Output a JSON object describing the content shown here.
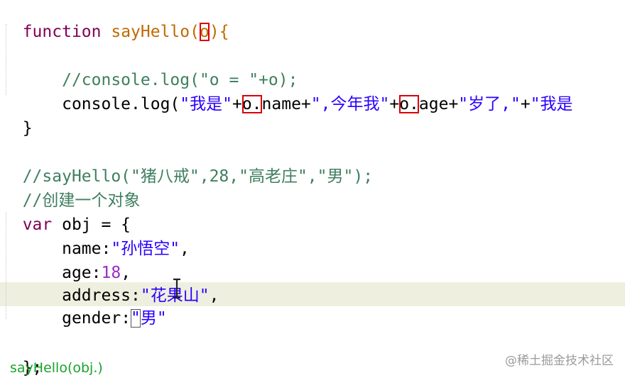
{
  "editor": {
    "lines": {
      "l1": {
        "kw": "function",
        "sp": " ",
        "fn": "sayHello",
        "open": "(",
        "param": "o",
        "close": "){"
      },
      "l3": {
        "text": "    //console.log(\"o = \"+o);"
      },
      "l4": {
        "indent": "    ",
        "call": "console.log(",
        "s1": "\"我是\"",
        "plus1": "+",
        "o1": "o.",
        "name": "name",
        "plus2": "+",
        "s2": "\",今年我\"",
        "plus3": "+",
        "o2": "o.",
        "age": "age",
        "plus4": "+",
        "s3": "\"岁了,\"",
        "plus5": "+",
        "s4": "\"我是"
      },
      "l5": {
        "text": "}"
      },
      "l7": {
        "text": "//sayHello(\"猪八戒\",28,\"高老庄\",\"男\");"
      },
      "l8": {
        "text": "//创建一个对象"
      },
      "l9": {
        "kw": "var",
        "rest": " obj = {"
      },
      "l10": {
        "indent": "    ",
        "key": "name",
        "colon": ":",
        "val": "\"孙悟空\"",
        "comma": ","
      },
      "l11": {
        "indent": "    ",
        "key": "age",
        "colon": ":",
        "val": "18",
        "comma": ","
      },
      "l12": {
        "indent": "    ",
        "key": "address",
        "colon": ":",
        "val": "\"花果山\"",
        "comma": ","
      },
      "l13": {
        "indent": "    ",
        "key": "gender",
        "colon": ":",
        "q1": "\"",
        "val": "男",
        "q2": "\""
      },
      "l15": {
        "text": "};"
      }
    }
  },
  "overlay": {
    "typed_hint": "sayHello(obj.)",
    "watermark": "@稀土掘金技术社区"
  }
}
